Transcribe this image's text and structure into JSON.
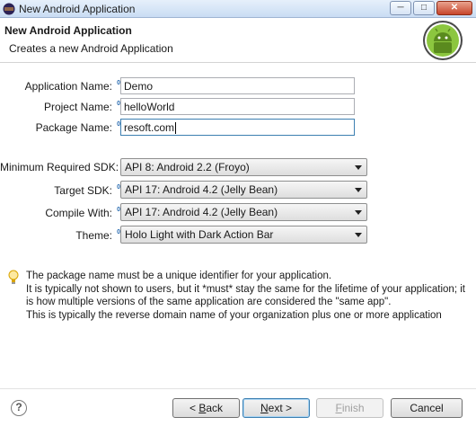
{
  "window": {
    "title": "New Android Application",
    "controls": [
      "minimize-icon",
      "maximize-icon",
      "close-icon"
    ]
  },
  "header": {
    "title": "New Android Application",
    "subtitle": "Creates a new Android Application",
    "logo": "android-logo-icon"
  },
  "form": {
    "app_name_label": "Application Name:",
    "app_name_value": "Demo",
    "project_name_label": "Project Name:",
    "project_name_value": "helloWorld",
    "package_name_label": "Package Name:",
    "package_name_value": "resoft.com",
    "min_sdk_label": "Minimum Required SDK:",
    "min_sdk_value": "API 8: Android 2.2 (Froyo)",
    "target_sdk_label": "Target SDK:",
    "target_sdk_value": "API 17: Android 4.2 (Jelly Bean)",
    "compile_with_label": "Compile With:",
    "compile_with_value": "API 17: Android 4.2 (Jelly Bean)",
    "theme_label": "Theme:",
    "theme_value": "Holo Light with Dark Action Bar",
    "info_marker": "0"
  },
  "hint": {
    "icon": "lightbulb-icon",
    "lines": [
      "The package name must be a unique identifier for your application.",
      "It is typically not shown to users, but it *must* stay the same for the lifetime of your application; it",
      "is how multiple versions of the same application are considered the \"same app\".",
      "This is typically the reverse domain name of your organization plus one or more application"
    ]
  },
  "footer": {
    "help_icon": "help-icon",
    "back_mnemonic": "B",
    "back_rest": "ack",
    "back_prefix": "< ",
    "next_mnemonic": "N",
    "next_rest": "ext >",
    "finish_mnemonic": "F",
    "finish_rest": "inish",
    "cancel_label": "Cancel"
  },
  "colors": {
    "titlebar": "#c9dcf3",
    "accent": "#3c7fb1",
    "android_green": "#8cc63f"
  }
}
